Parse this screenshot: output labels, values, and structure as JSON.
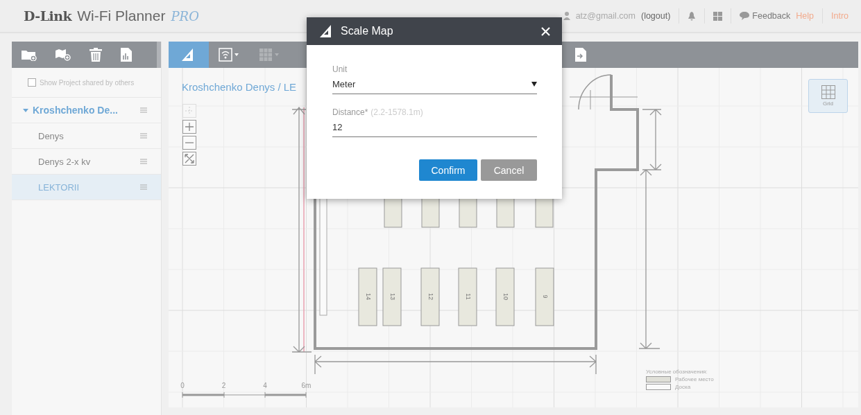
{
  "header": {
    "brand": "D-Link",
    "app_name": "Wi-Fi Planner",
    "edition": "PRO",
    "user_email": "atz@gmail.com",
    "logout": "(logout)",
    "links": [
      {
        "kind": "feedback",
        "label": "Feedback"
      },
      {
        "kind": "help",
        "label": "Help"
      },
      {
        "kind": "intro",
        "label": "Intro"
      }
    ]
  },
  "sidebar": {
    "tools": [
      {
        "kind": "add-folder"
      },
      {
        "kind": "add-map"
      },
      {
        "kind": "delete"
      },
      {
        "kind": "report"
      }
    ],
    "show_shared": {
      "label": "Show Project shared by others",
      "checked": false
    },
    "projects": [
      {
        "name": "Kroshchenko De...",
        "expanded": true,
        "children": [
          {
            "name": "Denys",
            "selected": false
          },
          {
            "name": "Denys 2-x kv",
            "selected": false
          },
          {
            "name": "LEKTORII",
            "selected": true
          }
        ]
      }
    ]
  },
  "map": {
    "tools": [
      {
        "kind": "scale",
        "selected": true,
        "disabled": false
      },
      {
        "kind": "wifi",
        "selected": false,
        "disabled": false
      },
      {
        "kind": "grid",
        "selected": false,
        "disabled": true
      },
      {
        "kind": "export",
        "selected": false,
        "disabled": false
      }
    ],
    "breadcrumb": "Kroshchenko Denys / LE",
    "grid_button": {
      "label": "Grid",
      "on": true
    },
    "desks": [
      "14",
      "13",
      "12",
      "11",
      "10",
      "9"
    ],
    "scale_bar": [
      "0",
      "2",
      "4",
      "6m"
    ],
    "legend": {
      "title": "Условные обозначения:",
      "items": [
        {
          "kind": "desk",
          "label": "Рабочее место"
        },
        {
          "kind": "board",
          "label": "Доска"
        }
      ]
    }
  },
  "dialog": {
    "title": "Scale Map",
    "unit": {
      "label": "Unit",
      "value": "Meter"
    },
    "distance": {
      "label": "Distance*",
      "hint": "(2.2-1578.1m)",
      "value": "12"
    },
    "buttons": [
      {
        "kind": "primary",
        "label": "Confirm"
      },
      {
        "kind": "secondary",
        "label": "Cancel"
      }
    ]
  }
}
